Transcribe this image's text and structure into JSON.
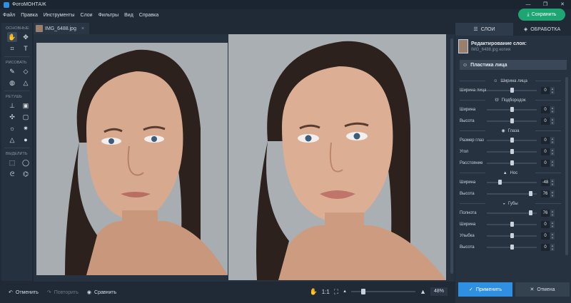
{
  "app": {
    "title": "ФотоМОНТАЖ"
  },
  "menu": [
    "Файл",
    "Правка",
    "Инструменты",
    "Слои",
    "Фильтры",
    "Вид",
    "Справка"
  ],
  "save_label": "Сохранить",
  "tool_groups": {
    "basic": "ОСНОВНЫЕ",
    "draw": "РИСОВАТЬ",
    "retouch": "РЕТУШЬ",
    "select": "ВЫДЕЛИТЬ"
  },
  "file_tab": {
    "name": "IMG_6488.jpg",
    "close": "×"
  },
  "bottom": {
    "undo": "Отменить",
    "redo": "Повторить",
    "compare": "Сравнить",
    "ratio": "1:1",
    "zoom": "48%",
    "zoom_fraction": 0.16
  },
  "right_panel": {
    "tab_layers": "СЛОИ",
    "tab_processing": "ОБРАБОТКА",
    "layer_title": "Редактирование слоя:",
    "layer_subtitle": "IMG_6488.jpg копия",
    "section": "Пластика лица",
    "groups": [
      {
        "name": "Ширина лица",
        "rows": [
          {
            "label": "Ширина лица",
            "value": "0",
            "pos": 0.5
          }
        ]
      },
      {
        "name": "Подбородок",
        "rows": [
          {
            "label": "Ширина",
            "value": "0",
            "pos": 0.5
          },
          {
            "label": "Высота",
            "value": "0",
            "pos": 0.5
          }
        ]
      },
      {
        "name": "Глаза",
        "rows": [
          {
            "label": "Размер глаз",
            "value": "0",
            "pos": 0.5
          },
          {
            "label": "Угол",
            "value": "0",
            "pos": 0.5
          },
          {
            "label": "Расстояние",
            "value": "0",
            "pos": 0.5
          }
        ]
      },
      {
        "name": "Нос",
        "rows": [
          {
            "label": "Ширина",
            "value": "-48",
            "pos": 0.26
          },
          {
            "label": "Высота",
            "value": "76",
            "pos": 0.88
          }
        ]
      },
      {
        "name": "Губы",
        "rows": [
          {
            "label": "Полнота",
            "value": "76",
            "pos": 0.88
          },
          {
            "label": "Ширина",
            "value": "0",
            "pos": 0.5
          },
          {
            "label": "Улыбка",
            "value": "0",
            "pos": 0.5
          },
          {
            "label": "Высота",
            "value": "0",
            "pos": 0.5
          }
        ]
      }
    ],
    "apply": "Применить",
    "cancel": "Отмена"
  }
}
